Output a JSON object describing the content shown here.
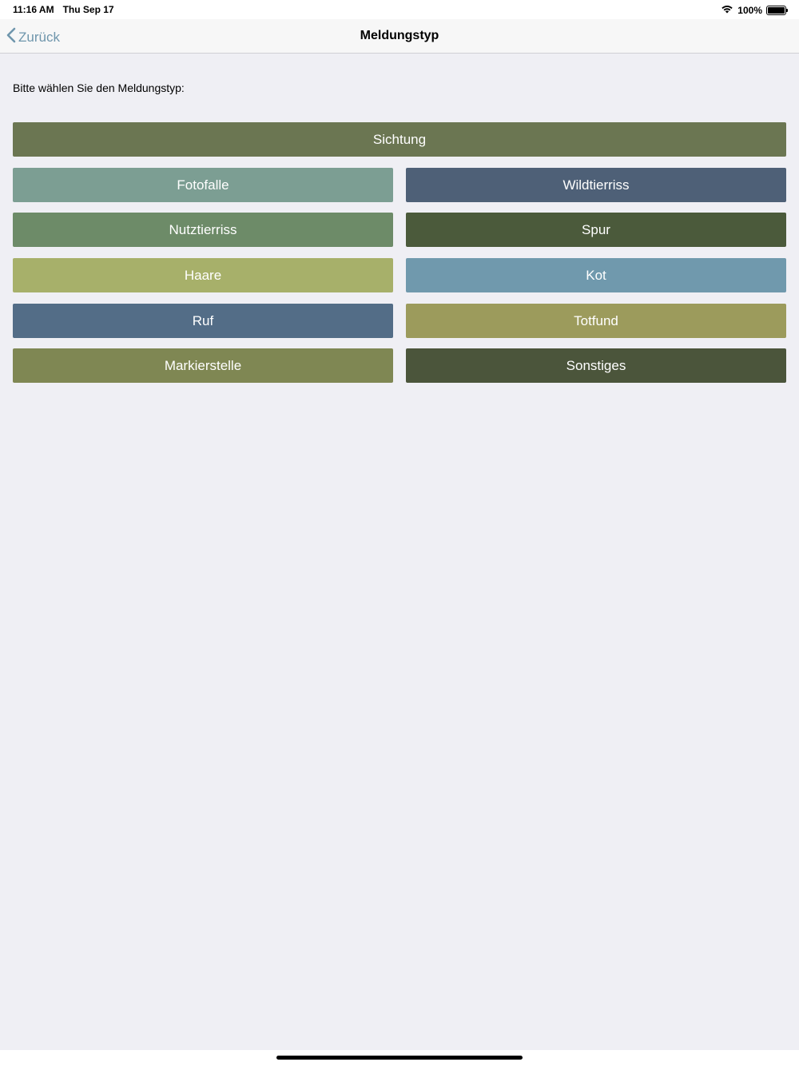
{
  "status_bar": {
    "time": "11:16 AM",
    "date": "Thu Sep 17",
    "battery_percent": "100%",
    "battery_level": 1.0,
    "wifi_icon": "wifi-icon",
    "battery_icon": "battery-icon"
  },
  "nav": {
    "back_label": "Zurück",
    "back_icon": "chevron-left-icon",
    "title": "Meldungstyp"
  },
  "prompt": "Bitte wählen Sie den Meldungstyp:",
  "buttons": {
    "sichtung": {
      "label": "Sichtung",
      "color": "#6b7652"
    },
    "fotofalle": {
      "label": "Fotofalle",
      "color": "#7c9e93"
    },
    "wildtierriss": {
      "label": "Wildtierriss",
      "color": "#4e6077"
    },
    "nutztierriss": {
      "label": "Nutztierriss",
      "color": "#6d8b68"
    },
    "spur": {
      "label": "Spur",
      "color": "#4b5a3b"
    },
    "haare": {
      "label": "Haare",
      "color": "#a7b06a"
    },
    "kot": {
      "label": "Kot",
      "color": "#7099ad"
    },
    "ruf": {
      "label": "Ruf",
      "color": "#536d87"
    },
    "totfund": {
      "label": "Totfund",
      "color": "#9c9b5c"
    },
    "markierstelle": {
      "label": "Markierstelle",
      "color": "#7f8753"
    },
    "sonstiges": {
      "label": "Sonstiges",
      "color": "#4b553b"
    }
  },
  "colors": {
    "background": "#efeff4",
    "accent": "#6f96ac"
  }
}
